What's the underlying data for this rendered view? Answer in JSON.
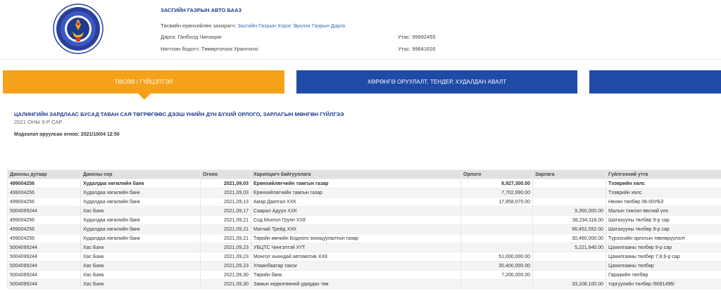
{
  "header": {
    "org_name": "ЗАСГИЙН ГАЗРЫН АВТО БААЗ",
    "manager_label": "Төсвийн ерөнхийлөн захирагч:",
    "manager_value": "Засгийн Газрын Хэрэг Эрхлэх Газрын Дарга",
    "director_label": "Дарга: Ганболд Чинзориг",
    "director_phone": "Утас: 99992455",
    "accountant_label": "Нягтлан бодогч: Төмөртогоох Урантогос",
    "accountant_phone": "Утас: 99841626"
  },
  "tabs": [
    {
      "label": "ТӨСӨВ / ГҮЙЦЭТГЭЛ",
      "active": true
    },
    {
      "label": "ХӨРӨНГӨ ОРУУЛАЛТ, ТЕНДЕР, ХУДАЛДАН АВАЛТ",
      "active": false
    },
    {
      "label": "",
      "active": false
    }
  ],
  "report": {
    "title": "ЦАЛИНГИЙН ЗАРДЛААС БУСАД ТАВАН САЯ ТӨГРӨГӨӨС ДЭЭШ ҮНИЙН ДҮН БҮХИЙ ОРЛОГО, ЗАРЛАГЫН МӨНГӨН ГҮЙЛГЭЭ",
    "subtitle": "2021 ОНЫ 9-Р САР",
    "updated": "Мэдээлэл оруулсан огноо: 2021/10/04 12:50"
  },
  "table": {
    "columns": [
      "Дансны дугаар",
      "Дансны нэр",
      "Огноо",
      "Харилцагч байгууллага",
      "Орлого",
      "Зарлага",
      "Гүйлгээний утга"
    ],
    "rows": [
      [
        "499004256",
        "Худалдаа хөгжлийн банк",
        "2021,09,03",
        "Ерөнхийлөгчийн тамгын газар",
        "8,927,300.00",
        "",
        "Тээврийн хөлс"
      ],
      [
        "499004256",
        "Худалдаа хөгжлийн банк",
        "2021,09,03",
        "Ерөнхийлөгчийн тамгын газар",
        "7,702,990.00",
        "",
        "Тээврийн хөлс"
      ],
      [
        "499004256",
        "Худалдаа хөгжлийн банк",
        "2021,09,13",
        "Амар Даатгал ХХК",
        "17,858,070.00",
        "",
        "Нөхөн төлбөр 06-00УБЗ"
      ],
      [
        "5004099244",
        "Хас Банк",
        "2021,09,17",
        "Саарал Адуун ХХК",
        "",
        "9,350,000.00",
        "Малын тэжээл өвсний үнэ"
      ],
      [
        "499004256",
        "Худалдаа хөгжлийн банк",
        "2021,09,21",
        "Сод Монгол Групп ХХК",
        "",
        "38,234,118.00",
        "Шатахууны төлбөр 9-р сар"
      ],
      [
        "499004256",
        "Худалдаа хөгжлийн банк",
        "2021,09,21",
        "Магнай Трейд ХХК",
        "",
        "66,452,552.00",
        "Шатахууны төлбөр 9-р сар"
      ],
      [
        "499004256",
        "Худалдаа хөгжлийн банк",
        "2021,09,21",
        "Төрийн өмчийн Бодлого зохицуулалтын газар",
        "",
        "30,480,000.00",
        "Түрээсийн орлогын төвлөрүүлэлт"
      ],
      [
        "5004099244",
        "Хас Банк",
        "2021,09,23",
        "УБЦТС Чингэлтэй ХҮТ",
        "",
        "5,221,840.00",
        "Цахилгааны төлбөр 9-р сар"
      ],
      [
        "5004099244",
        "Хас Банк",
        "2021,09,23",
        "Монгол хьюндай автомотив ХХК",
        "51,000,000.00",
        "",
        "Цахилгааны төлбөр 7,8,9-р сар"
      ],
      [
        "5004099244",
        "Хас Банк",
        "2021,09,23",
        "Улаанбаатар такси",
        "30,400,000.00",
        "",
        "Цахилгааны төлбөр"
      ],
      [
        "5004099244",
        "Хас Банк",
        "2021,09,30",
        "Төрийн банк",
        "7,200,000.00",
        "",
        "Гаражийн төлбөр"
      ],
      [
        "5004099244",
        "Хас Банк",
        "2021,09,30",
        "Замын хөдөлгөөний удирдах төв",
        "",
        "33,108,100.00",
        "торгуулийн төлбөр /9081496/"
      ]
    ]
  },
  "colors": {
    "accent_orange": "#f5a21a",
    "accent_blue": "#1e4aa8",
    "title_blue": "#1f3b8f"
  },
  "icons": {
    "emblem": "state-emblem-icon"
  }
}
